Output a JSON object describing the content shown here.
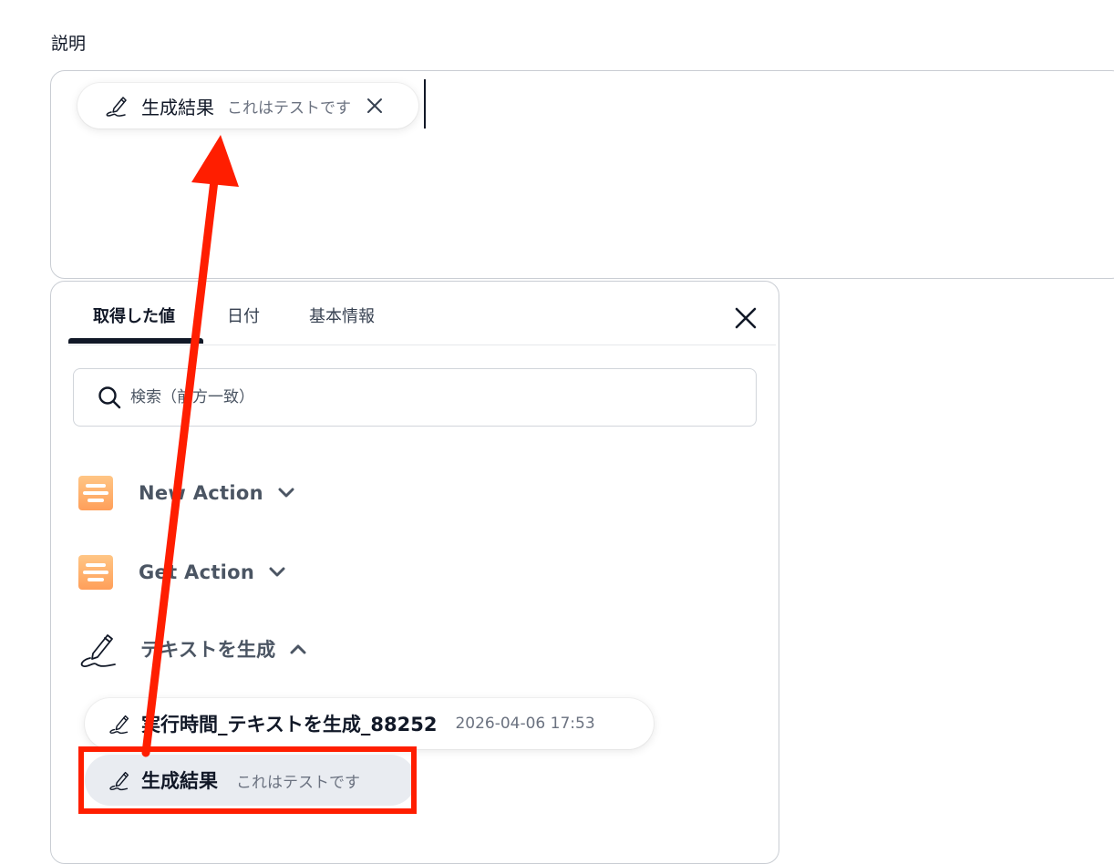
{
  "field": {
    "label": "説明"
  },
  "chip": {
    "title": "生成結果",
    "value": "これはテストです",
    "close_icon": "close-icon"
  },
  "panel": {
    "tabs": [
      {
        "label": "取得した値",
        "active": true
      },
      {
        "label": "日付",
        "active": false
      },
      {
        "label": "基本情報",
        "active": false
      }
    ],
    "search": {
      "placeholder": "検索（前方一致）",
      "value": ""
    },
    "groups": [
      {
        "label": "New Action",
        "icon": "app-logo-icon",
        "expanded": false
      },
      {
        "label": "Get Action",
        "icon": "app-logo-icon",
        "expanded": false
      },
      {
        "label": "テキストを生成",
        "icon": "pen-signature-icon",
        "expanded": true
      }
    ],
    "items": [
      {
        "title": "実行時間_テキストを生成_88252",
        "value": "2026-04-06 17:53",
        "icon": "pen-signature-icon"
      },
      {
        "title": "生成結果",
        "value": "これはテストです",
        "icon": "pen-signature-icon",
        "selected": true
      }
    ]
  },
  "colors": {
    "annotation_red": "#ff1e00",
    "brand_orange": "#ffb26b",
    "selected_item_bg": "#e9ecf1"
  }
}
